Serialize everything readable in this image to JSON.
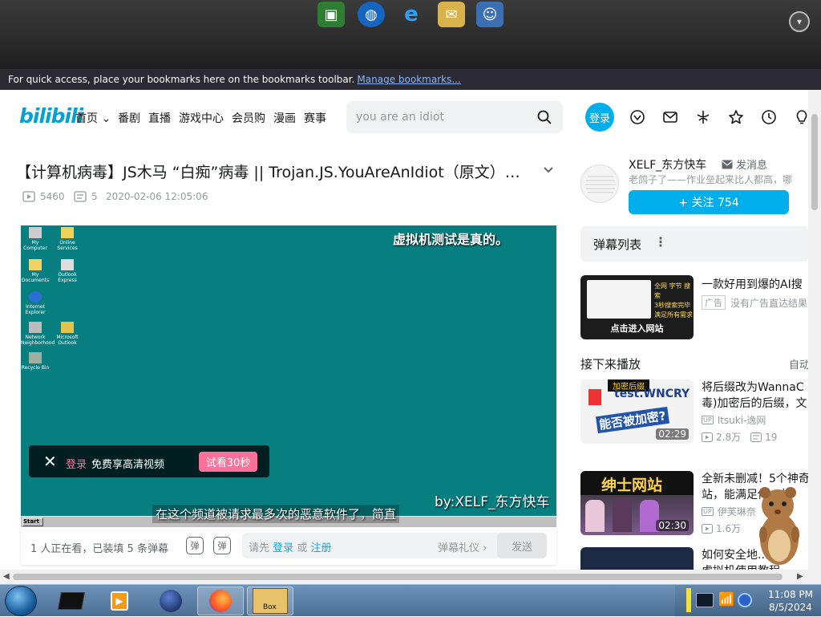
{
  "browser": {
    "bookmarks_text": "For quick access, place your bookmarks here on the bookmarks toolbar.",
    "manage_link": "Manage bookmarks..."
  },
  "header": {
    "logo": "bilibili",
    "nav": [
      {
        "label": "首页"
      },
      {
        "label": "番剧"
      },
      {
        "label": "直播"
      },
      {
        "label": "游戏中心"
      },
      {
        "label": "会员购"
      },
      {
        "label": "漫画"
      },
      {
        "label": "赛事"
      }
    ],
    "search_value": "you are an idiot",
    "login_label": "登录"
  },
  "video": {
    "title": "【计算机病毒】JS木马 “白痴”病毒 || Trojan.JS.YouAreAnIdiot（原文）…",
    "plays": "5460",
    "danmaku_count": "5",
    "date": "2020-02-06 12:05:06"
  },
  "player": {
    "top_subtitle": "虚拟机测试是真的。",
    "watermark": "by:XELF_东方快车",
    "subtitle": "在这个频道被请求最多次的恶意软件了，简直",
    "login_link": "登录",
    "login_text": "免费享高清视频",
    "try_label": "试看30秒",
    "desktop_icons": [
      {
        "label": "My Computer"
      },
      {
        "label": "Online Services"
      },
      {
        "label": "My Documents"
      },
      {
        "label": "Outlook Express"
      },
      {
        "label": "Internet Explorer"
      },
      {
        "label": "Network Neighborhood"
      },
      {
        "label": "Microsoft Outlook"
      },
      {
        "label": "Recycle Bin"
      }
    ],
    "vm_start": "Start"
  },
  "danmaku_bar": {
    "viewers": "1 人正在看，已装填 5 条弹幕",
    "hint_prefix": "请先",
    "hint_login": "登录",
    "hint_or": "或",
    "hint_register": "注册",
    "etiquette": "弹幕礼仪 ›",
    "send": "发送",
    "toggle1": "弹",
    "toggle2": "弹"
  },
  "sidebar": {
    "up_name": "XELF_东方快车",
    "msg_label": "发消息",
    "up_desc": "老鸽子了——作业垒起来比人都高，哪",
    "follow_label": "+ 关注 754",
    "danmaku_list_label": "弹幕列表",
    "ad": {
      "title": "一款好用到爆的AI搜",
      "tag": "广告",
      "tag_text": "没有广告直达结果",
      "thumb_lines": [
        "全网 字节 搜索",
        "3秒搜索完毕",
        "满足所有需求"
      ],
      "thumb_cta": "点击进入网站"
    },
    "next_label": "接下来播放",
    "autoplay": "自动",
    "recommendations": [
      {
        "title1": "将后缀改为WannaC",
        "title2": "毒)加密后的后缀，文",
        "up": "Itsuki-逸网",
        "views": "2.8万",
        "comments": "19",
        "duration": "02:29",
        "thumb_text": "test.WNCRY",
        "thumb_sub": "能否被加密?",
        "thumb_tag": "加密后缀"
      },
      {
        "title1": "全新未删减！5个神奇",
        "title2": "站，能满足你一些",
        "up": "伊芙琳奈",
        "views": "1.6万",
        "comments": "",
        "duration": "02:30",
        "thumb_text": "绅士网站"
      },
      {
        "title1": "如何安全地...",
        "title2": "虚拟机使用教程",
        "up": "",
        "views": "",
        "comments": "",
        "duration": "",
        "thumb_text": ""
      }
    ]
  },
  "taskbar": {
    "time": "11:08 PM",
    "date": "8/5/2024",
    "box_label": "Box"
  },
  "colors": {
    "accent": "#00aeec",
    "pink": "#fb7299",
    "player_bg": "#077e80"
  }
}
